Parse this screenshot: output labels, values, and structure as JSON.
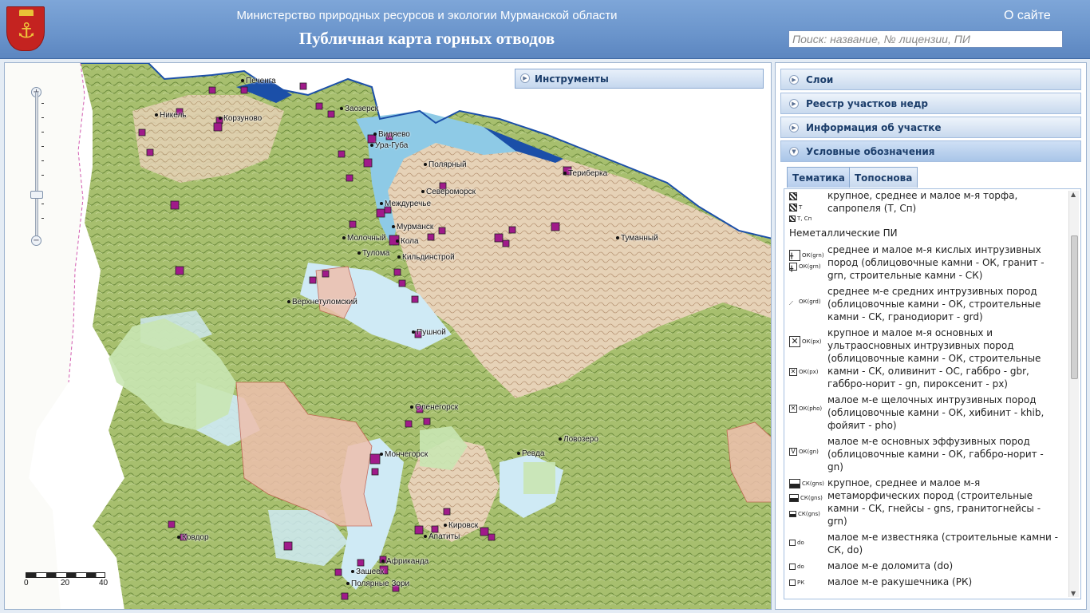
{
  "header": {
    "ministry": "Министерство природных ресурсов и экологии Мурманской области",
    "title": "Публичная карта горных отводов",
    "about_link": "О сайте",
    "search_placeholder": "Поиск: название, № лицензии, ПИ"
  },
  "map": {
    "tools_button": "Инструменты",
    "scale": {
      "labels": [
        "0",
        "20",
        "40"
      ]
    },
    "cities": [
      {
        "name": "Печенга"
      },
      {
        "name": "Никель"
      },
      {
        "name": "Корзуново"
      },
      {
        "name": "Заозерск"
      },
      {
        "name": "Видяево"
      },
      {
        "name": "Ура-Губа"
      },
      {
        "name": "Полярный"
      },
      {
        "name": "Териберка"
      },
      {
        "name": "Североморск"
      },
      {
        "name": "Междуречье"
      },
      {
        "name": "Мурманск"
      },
      {
        "name": "Молочный"
      },
      {
        "name": "Кола"
      },
      {
        "name": "Тулома"
      },
      {
        "name": "Кильдинстрой"
      },
      {
        "name": "Туманный"
      },
      {
        "name": "Верхнетуломский"
      },
      {
        "name": "Пушной"
      },
      {
        "name": "Оленегорск"
      },
      {
        "name": "Мончегорск"
      },
      {
        "name": "Ревда"
      },
      {
        "name": "Ловозеро"
      },
      {
        "name": "Ковдор"
      },
      {
        "name": "Кировск"
      },
      {
        "name": "Апатиты"
      },
      {
        "name": "Африканда"
      },
      {
        "name": "Зашеек"
      },
      {
        "name": "Полярные Зори"
      }
    ],
    "colors": {
      "land": "#b7c97a",
      "water": "#cfeaf5",
      "sea": "#ffffff",
      "marker": "#a01a8a",
      "protected": "#c9e6b3",
      "license_area": "#eebfad"
    }
  },
  "panel": {
    "accordion": [
      {
        "label": "Слои",
        "active": false
      },
      {
        "label": "Реестр участков недр",
        "active": false
      },
      {
        "label": "Информация об участке",
        "active": false
      },
      {
        "label": "Условные обозначения",
        "active": true
      }
    ],
    "tabs": [
      {
        "label": "Тематика",
        "active": true
      },
      {
        "label": "Топоснова",
        "active": false
      }
    ],
    "legend": {
      "items": [
        {
          "text": "крупное, среднее и малое м-я торфа, сапропеля (Т, Сп)",
          "codes": [
            "Т",
            "Т, Сп"
          ]
        },
        {
          "section": "Неметаллические ПИ"
        },
        {
          "text": "среднее и малое м-я кислых интрузивных пород (облицовочные камни - ОК, гранит - grn, строительные камни - СК)",
          "codes": [
            "ОК(grn)",
            "ОК(grn)"
          ]
        },
        {
          "text": "среднее м-е средних интрузивных пород (облицовочные камни - ОК, строительные камни - СК, гранодиорит - grd)",
          "codes": [
            "ОК(grd)"
          ]
        },
        {
          "text": "крупное и малое м-я основных и ультраосновных интрузивных пород (облицовочные камни - ОК, строительные камни - СК, оливинит - ОС, габбро - gbr, габбро-норит - gn, пироксенит - px)",
          "codes": [
            "ОК(px)",
            "ОК(px)"
          ]
        },
        {
          "text": "малое м-е щелочных интрузивных пород (облицовочные камни - ОК, хибинит - khib, фойяит - pho)",
          "codes": [
            "ОК(pho)"
          ]
        },
        {
          "text": "малое м-е основных эффузивных пород (облицовочные камни - ОК, габбро-норит - gn)",
          "codes": [
            "ОК(gn)"
          ]
        },
        {
          "text": "крупное, среднее и малое м-я метаморфических пород (строительные камни - СК, гнейсы - gns, гранитогнейсы - grn)",
          "codes": [
            "СК(gns)",
            "СК(gns)",
            "СК(gns)"
          ]
        },
        {
          "text": "малое м-е известняка (строительные камни - СК, do)",
          "codes": [
            "do"
          ]
        },
        {
          "text": "малое м-е доломита (do)",
          "codes": [
            "do"
          ]
        },
        {
          "text": "малое м-е ракушечника (РК)",
          "codes": [
            "РК"
          ]
        }
      ]
    }
  }
}
